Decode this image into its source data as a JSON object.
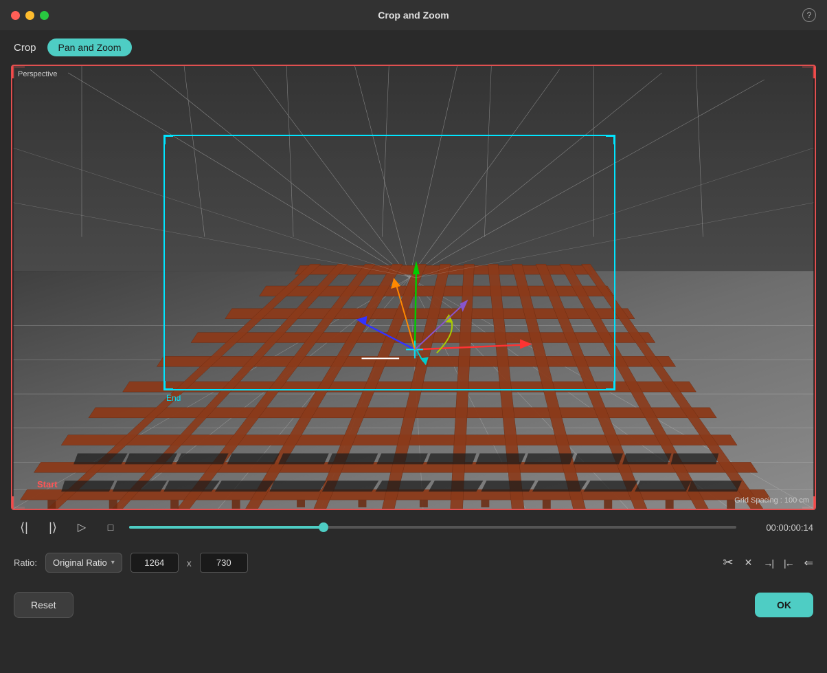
{
  "window": {
    "title": "Crop and Zoom",
    "help_label": "?"
  },
  "traffic_lights": {
    "red": "#ff5f57",
    "yellow": "#febc2e",
    "green": "#28c840"
  },
  "tabs": {
    "crop_label": "Crop",
    "pan_zoom_label": "Pan and Zoom"
  },
  "viewport": {
    "perspective_label": "Perspective",
    "grid_spacing_label": "Grid Spacing : 100 cm",
    "start_label": "Start",
    "end_label": "End"
  },
  "playback": {
    "step_back_icon": "⟨⟨",
    "step_forward_icon": "⟩",
    "play_icon": "▷",
    "stop_icon": "□",
    "timecode": "00:00:00:14",
    "scrubber_pct": 32
  },
  "ratio": {
    "label": "Ratio:",
    "selected": "Original Ratio",
    "width": "1264",
    "height": "730",
    "x_separator": "x"
  },
  "ratio_actions": {
    "fit_icon": "⤢",
    "close_icon": "✕",
    "align_right_icon": "→|",
    "align_left_icon": "|←",
    "swap_icon": "⇐"
  },
  "footer": {
    "reset_label": "Reset",
    "ok_label": "OK"
  }
}
